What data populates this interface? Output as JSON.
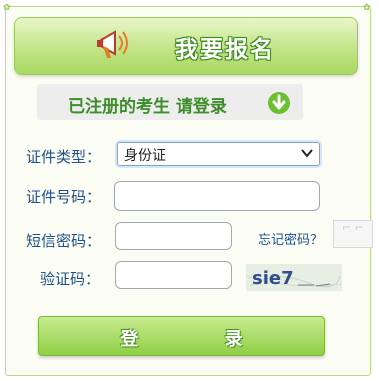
{
  "header": {
    "title": "我要报名"
  },
  "login_bar": {
    "text": "已注册的考生  请登录"
  },
  "form": {
    "id_type_label": "证件类型：",
    "id_type_selected": "身份证",
    "id_number_label": "证件号码：",
    "password_label": "短信密码：",
    "forgot_password": "忘记密码？",
    "captcha_label": "验证码：",
    "captcha_text": "sie7"
  },
  "submit": {
    "label": "登 录"
  },
  "colors": {
    "accent_green": "#3e8d2a",
    "label_blue": "#1f4f8f"
  }
}
